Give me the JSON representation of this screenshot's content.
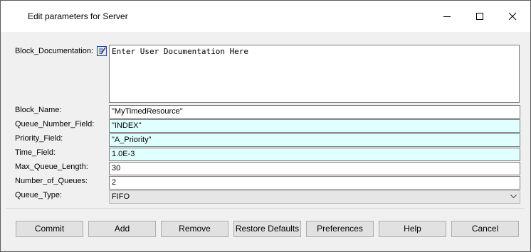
{
  "window": {
    "title": "Edit parameters for Server",
    "controls": [
      "minimize-icon",
      "maximize-icon",
      "close-icon"
    ]
  },
  "form": {
    "documentation": {
      "label": "Block_Documentation:",
      "value": "Enter User Documentation Here",
      "icon": "edit-document-icon"
    },
    "fields": [
      {
        "label": "Block_Name:",
        "value": "\"MyTimedResource\""
      },
      {
        "label": "Queue_Number_Field:",
        "value": "\"INDEX\""
      },
      {
        "label": "Priority_Field:",
        "value": "\"A_Priority\""
      },
      {
        "label": "Time_Field:",
        "value": "1.0E-3"
      },
      {
        "label": "Max_Queue_Length:",
        "value": "30"
      },
      {
        "label": "Number_of_Queues:",
        "value": "2"
      },
      {
        "label": "Queue_Type:",
        "value": "FIFO"
      }
    ],
    "field_colors": {
      "highlight": "#e0ffff",
      "select": "#e6e6e6"
    }
  },
  "buttons": [
    {
      "label": "Commit"
    },
    {
      "label": "Add"
    },
    {
      "label": "Remove"
    },
    {
      "label": "Restore Defaults"
    },
    {
      "label": "Preferences"
    },
    {
      "label": "Help"
    },
    {
      "label": "Cancel"
    }
  ]
}
